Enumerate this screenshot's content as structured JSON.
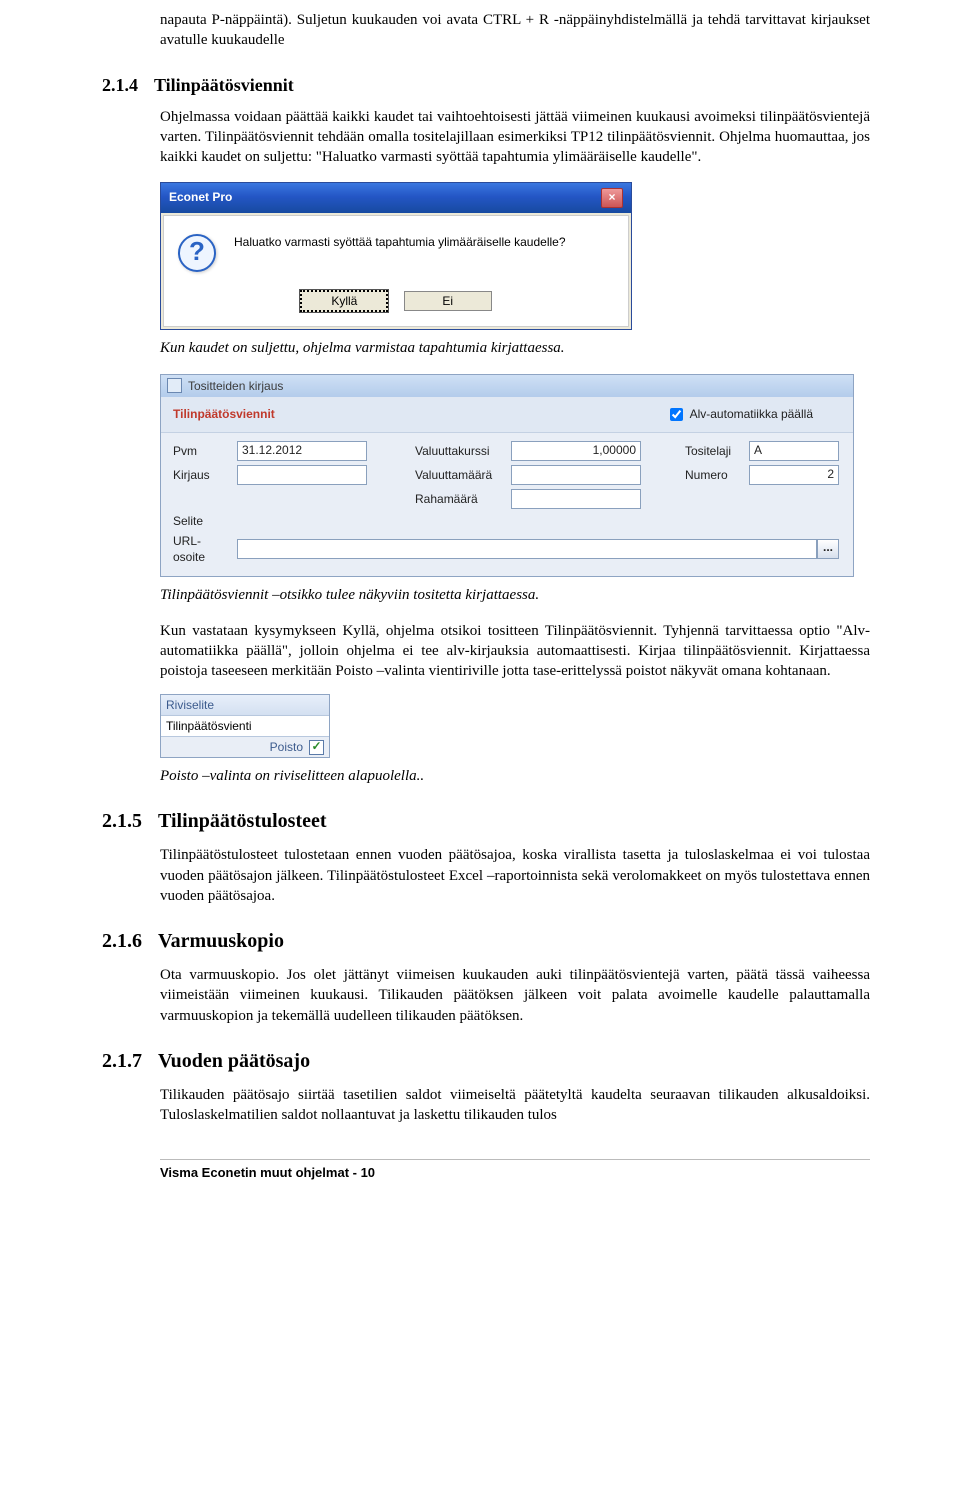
{
  "intro": {
    "p1": "napauta P-näppäintä). Suljetun kuukauden voi avata CTRL + R -näppäinyhdistelmällä ja tehdä tarvittavat kirjaukset avatulle kuukaudelle"
  },
  "sec214": {
    "num": "2.1.4",
    "title": "Tilinpäätösviennit",
    "p1": "Ohjelmassa voidaan päättää kaikki kaudet tai vaihtoehtoisesti jättää viimeinen kuukausi avoimeksi tilinpäätösvientejä varten. Tilinpäätösviennit tehdään omalla tositelajillaan esimerkiksi TP12 tilinpäätösviennit. Ohjelma huomauttaa, jos kaikki kaudet on suljettu: \"Haluatko varmasti syöttää tapahtumia ylimääräiselle kaudelle\".",
    "dialog1": {
      "title": "Econet Pro",
      "close": "×",
      "question_mark": "?",
      "message": "Haluatko varmasti syöttää tapahtumia ylimääräiselle kaudelle?",
      "btn_yes": "Kyllä",
      "btn_no": "Ei"
    },
    "caption1": "Kun kaudet on suljettu, ohjelma varmistaa tapahtumia kirjattaessa.",
    "panel2": {
      "window_title": "Tositteiden kirjaus",
      "title": "Tilinpäätösviennit",
      "alv_label": "Alv-automatiikka päällä",
      "alv_checked": true,
      "rows": {
        "pvm_label": "Pvm",
        "pvm_value": "31.12.2012",
        "kirjaus_label": "Kirjaus",
        "valkurssi_label": "Valuuttakurssi",
        "valkurssi_value": "1,00000",
        "valmaara_label": "Valuuttamäärä",
        "rahamaara_label": "Rahamäärä",
        "tositelaji_label": "Tositelaji",
        "tositelaji_value": "A",
        "numero_label": "Numero",
        "numero_value": "2",
        "selite_label": "Selite",
        "url_label": "URL- osoite",
        "ellipsis": "..."
      }
    },
    "caption2": "Tilinpäätösviennit –otsikko tulee näkyviin tositetta kirjattaessa.",
    "p2": "Kun vastataan kysymykseen Kyllä, ohjelma otsikoi tositteen Tilinpäätösviennit. Tyhjennä tarvittaessa optio \"Alv-automatiikka päällä\", jolloin ohjelma ei tee alv-kirjauksia automaattisesti. Kirjaa tilinpäätösviennit. Kirjattaessa poistoja taseeseen merkitään Poisto –valinta vientiriville jotta tase-erittelyssä poistot näkyvät omana kohtanaan.",
    "panel3": {
      "head": "Riviselite",
      "value": "Tilinpäätösvienti",
      "poisto_label": "Poisto",
      "poisto_check": "✓"
    },
    "caption3": "Poisto –valinta on  riviselitteen alapuolella.."
  },
  "sec215": {
    "num": "2.1.5",
    "title": "Tilinpäätöstulosteet",
    "p1": "Tilinpäätöstulosteet tulostetaan ennen vuoden päätösajoa, koska virallista tasetta ja tuloslaskelmaa ei voi tulostaa vuoden päätösajon jälkeen. Tilinpäätöstulosteet Excel –raportoinnista sekä verolomakkeet on myös tulostettava ennen vuoden päätösajoa."
  },
  "sec216": {
    "num": "2.1.6",
    "title": "Varmuuskopio",
    "p1": "Ota varmuuskopio. Jos olet jättänyt viimeisen kuukauden auki tilinpäätösvientejä varten, päätä tässä vaiheessa viimeistään viimeinen kuukausi. Tilikauden päätöksen jälkeen voit palata avoimelle kaudelle palauttamalla varmuuskopion ja tekemällä uudelleen tilikauden päätöksen."
  },
  "sec217": {
    "num": "2.1.7",
    "title": "Vuoden päätösajo",
    "p1": "Tilikauden päätösajo siirtää tasetilien saldot viimeiseltä päätetyltä kaudelta seuraavan tilikauden alkusaldoiksi. Tuloslaskelmatilien saldot nollaantuvat ja laskettu tilikauden tulos"
  },
  "footer": "Visma Econetin muut ohjelmat - 10"
}
